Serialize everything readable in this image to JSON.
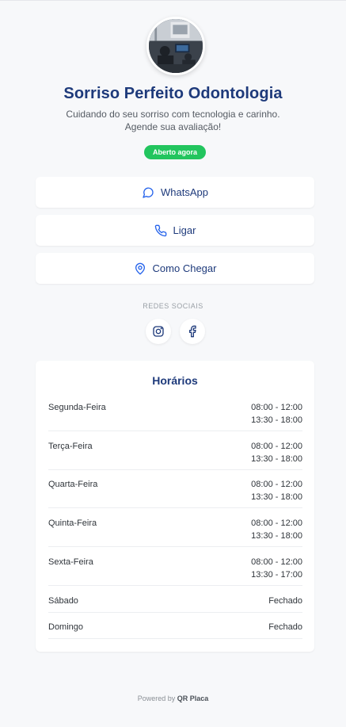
{
  "profile": {
    "name": "Sorriso Perfeito Odontologia",
    "description_line1": "Cuidando do seu sorriso com tecnologia e carinho.",
    "description_line2": "Agende sua avaliação!",
    "status_badge": "Aberto agora",
    "status_color": "#22c55e"
  },
  "actions": {
    "whatsapp": {
      "label": "WhatsApp",
      "icon": "chat-bubble-icon"
    },
    "call": {
      "label": "Ligar",
      "icon": "phone-icon"
    },
    "directions": {
      "label": "Como Chegar",
      "icon": "map-pin-icon"
    }
  },
  "social": {
    "title": "REDES SOCIAIS",
    "links": [
      {
        "name": "Instagram",
        "icon": "instagram-icon"
      },
      {
        "name": "Facebook",
        "icon": "facebook-icon"
      }
    ]
  },
  "hours": {
    "title": "Horários",
    "days": [
      {
        "day": "Segunda-Feira",
        "line1": "08:00 - 12:00",
        "line2": "13:30 - 18:00"
      },
      {
        "day": "Terça-Feira",
        "line1": "08:00 - 12:00",
        "line2": "13:30 - 18:00"
      },
      {
        "day": "Quarta-Feira",
        "line1": "08:00 - 12:00",
        "line2": "13:30 - 18:00"
      },
      {
        "day": "Quinta-Feira",
        "line1": "08:00 - 12:00",
        "line2": "13:30 - 18:00"
      },
      {
        "day": "Sexta-Feira",
        "line1": "08:00 - 12:00",
        "line2": "13:30 - 17:00"
      },
      {
        "day": "Sábado",
        "line1": "Fechado"
      },
      {
        "day": "Domingo",
        "line1": "Fechado"
      }
    ]
  },
  "footer": {
    "prefix": "Powered by",
    "brand": "QR Placa"
  },
  "colors": {
    "accent": "#1e3a7b",
    "background": "#f7f8fa",
    "card": "#ffffff"
  }
}
